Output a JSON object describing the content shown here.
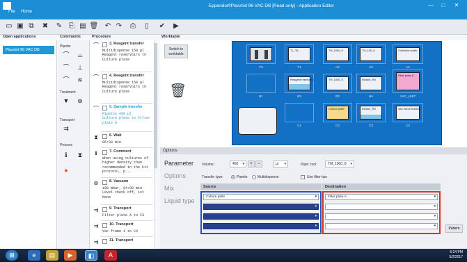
{
  "window": {
    "title": "Eppendorf/Plasmid 96 VAC DB [Read only] - Application Editor",
    "menu": [
      "File",
      "Home"
    ],
    "controls": [
      "minimize-icon",
      "maximize-icon",
      "close-icon"
    ]
  },
  "toolbar": {
    "icons": [
      "open-icon",
      "save-icon",
      "save-as-icon",
      "close-file-icon",
      "edit-icon",
      "copy-icon",
      "paste-icon",
      "delete-icon",
      "undo-icon",
      "redo-icon",
      "print-icon",
      "preview-icon",
      "validate-icon",
      "run-icon"
    ]
  },
  "columns": {
    "open_apps": "Open applications",
    "commands": "Commands",
    "procedure": "Procedure",
    "worktable": "Worktable"
  },
  "open_apps": [
    "Plasmid 96 VAC DB"
  ],
  "commands": {
    "pipette": "Pipette",
    "treatment": "Treatment",
    "transport": "Transport",
    "process": "Process"
  },
  "procedure": [
    {
      "title": "3. Reagent transfer",
      "desc": "Multidispense 150 µl\nReagent reservoirs to Culture plate",
      "icon": "multidispense-icon"
    },
    {
      "title": "4. Reagent transfer",
      "desc": "Multidispense 150 µl\nReagent reservoirs to Culture plate",
      "icon": "multidispense-icon"
    },
    {
      "title": "5. Sample transfer",
      "desc": "Pipette 450 µl\nCulture plate to Filter plate A",
      "icon": "pipette-icon",
      "selected": true
    },
    {
      "title": "6. Wait",
      "desc": "05:00 min",
      "icon": "hourglass-icon"
    },
    {
      "title": "7. Comment",
      "desc": "When using cultures of higher density than recommended in the kit protocol, p...",
      "icon": "comment-icon"
    },
    {
      "title": "8. Vacuum",
      "desc": "180 mbar, 04:00 min\nLevel check off, 1st None",
      "icon": "vacuum-icon"
    },
    {
      "title": "9. Transport",
      "desc": "Filter plate A to C3",
      "icon": "transport-icon"
    },
    {
      "title": "10. Transport",
      "desc": "Vac frame 1 to C4",
      "icon": "transport-icon"
    },
    {
      "title": "11. Transport",
      "desc": "",
      "icon": "transport-icon"
    }
  ],
  "worktable": {
    "switch_label": "Switch to worktable",
    "slots": [
      {
        "label": "T0",
        "item": "Tips",
        "fill": "#3a3f48"
      },
      {
        "label": "T1",
        "item": "TL_TA",
        "fill": ""
      },
      {
        "label": "A2",
        "item": "TH_1000_0",
        "fill": ""
      },
      {
        "label": "A3",
        "item": "TH_100_0",
        "fill": ""
      },
      {
        "label": "A4",
        "item": "Collection plate",
        "fill": ""
      },
      {
        "label": "B1",
        "item": "",
        "fill": ""
      },
      {
        "label": "B2",
        "item": "Reagent reservoirs",
        "fill": "#7fc7ea"
      },
      {
        "label": "B3",
        "item": "TH_1000_0",
        "fill": ""
      },
      {
        "label": "B4",
        "item": "Elution_RS",
        "fill": ""
      },
      {
        "label": "B5",
        "item": "Filter plate A",
        "fill": "#f2a9cf"
      },
      {
        "label": "C1",
        "item": "",
        "fill": ""
      },
      {
        "label": "C2",
        "item": "Culture plate",
        "fill": "#f6d98a"
      },
      {
        "label": "C3",
        "item": "Elution_RS",
        "fill": ""
      },
      {
        "label": "C4",
        "item": "Vac frame holder",
        "fill": ""
      },
      {
        "label": "Waste",
        "item": "",
        "fill": ""
      }
    ],
    "vac_label": "VAC_UNIT"
  },
  "options": {
    "header": "Options",
    "nav": [
      "Parameter",
      "Options",
      "Mix",
      "Liquid type"
    ],
    "volume_label": "Volume:",
    "volume_value": "450",
    "volume_unit": "µl",
    "pipette_tool_label": "Pipet. tool:",
    "pipette_tool_value": "TM_1000_8",
    "transfer_type_label": "Transfer type:",
    "transfer_pipette": "Pipette",
    "transfer_multi": "Multidispense",
    "filter_tips_label": "Use filter tips",
    "source_header": "Source",
    "destination_header": "Destination",
    "source_rows": [
      "Culture plate",
      "",
      "",
      ""
    ],
    "destination_rows": [
      "Filter plate A",
      "",
      "",
      ""
    ],
    "pattern_label": "Pattern"
  },
  "taskbar": {
    "icons": [
      "start-icon",
      "browser-icon",
      "explorer-icon",
      "media-icon",
      "app-icon",
      "pdf-icon"
    ],
    "tray_time": "6:24 PM",
    "tray_date": "5/2/2017"
  }
}
